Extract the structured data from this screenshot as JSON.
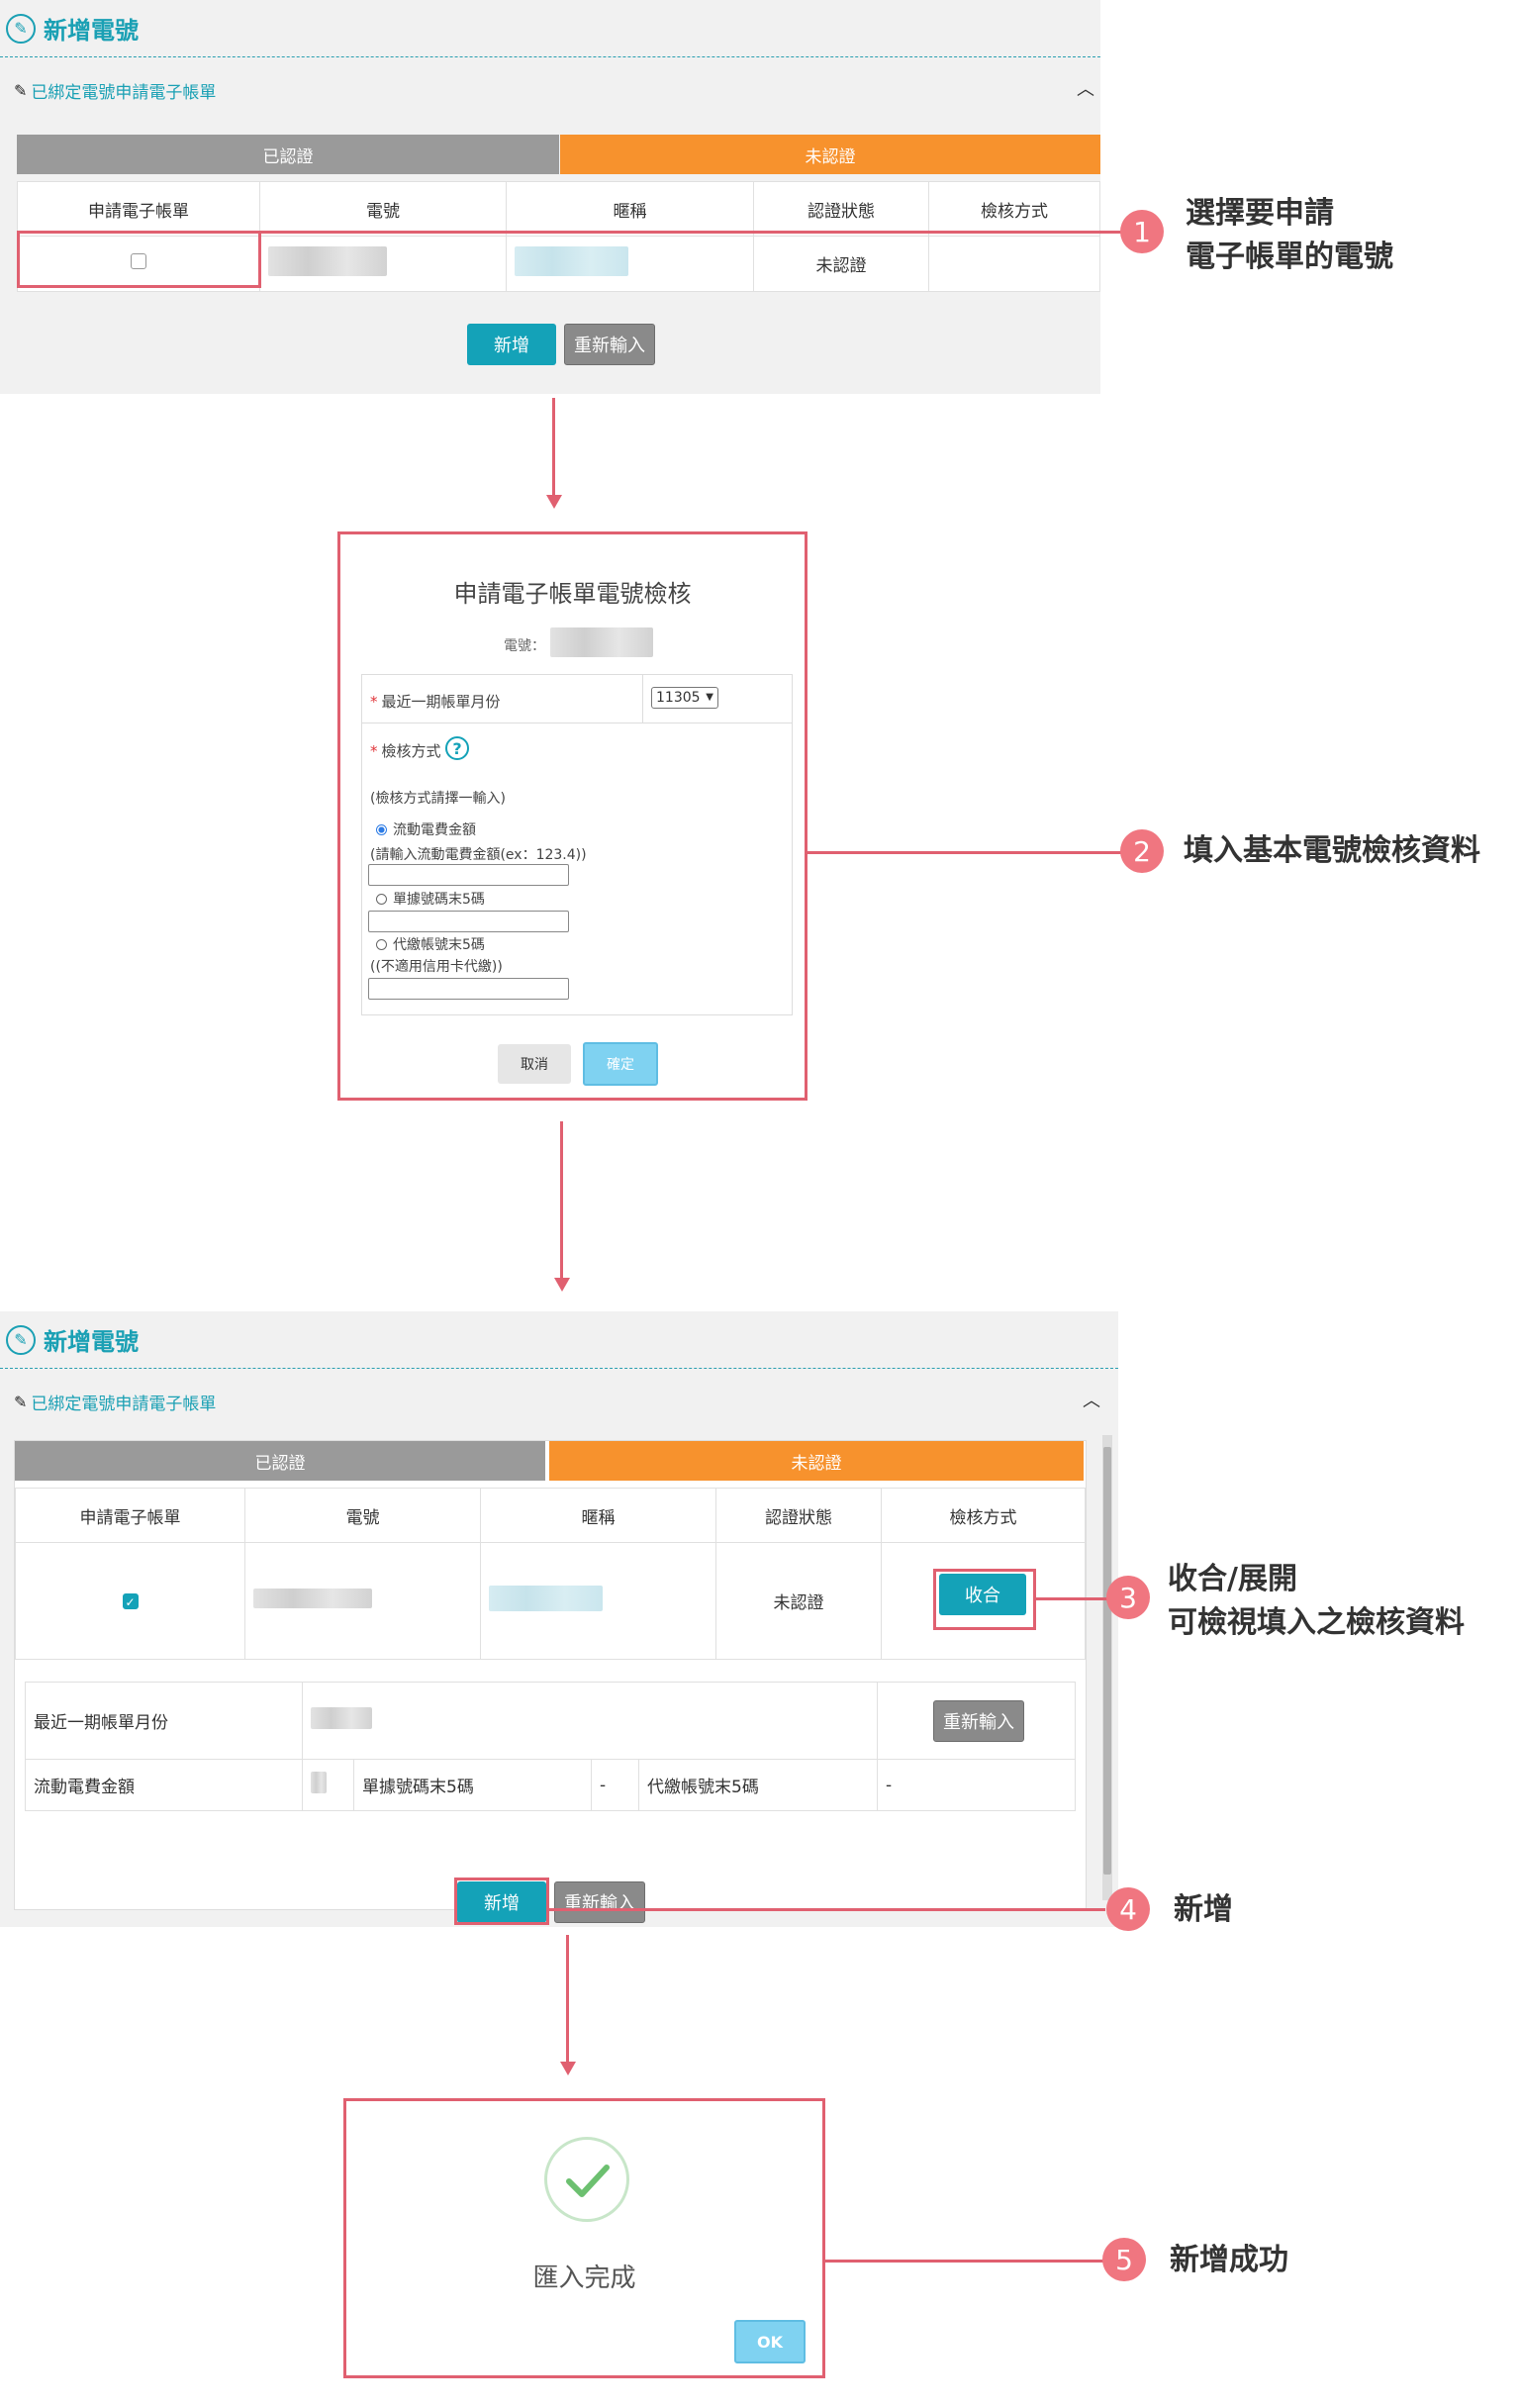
{
  "panel1": {
    "title": "新增電號",
    "section": "已綁定電號申請電子帳單",
    "tab_verified": "已認證",
    "tab_unverified": "未認證",
    "headers": [
      "申請電子帳單",
      "電號",
      "暱稱",
      "認證狀態",
      "檢核方式"
    ],
    "row_status": "未認證",
    "btn_add": "新增",
    "btn_reset": "重新輸入"
  },
  "dialog": {
    "title": "申請電子帳單電號檢核",
    "account_label": "電號：",
    "latest_month_label": "最近一期帳單月份",
    "month_value": "11305",
    "method_label": "檢核方式",
    "method_hint": "(檢核方式請擇一輸入)",
    "opt1": "流動電費金額",
    "opt1_hint": "(請輸入流動電費金額(ex：123.4))",
    "opt2": "單據號碼末5碼",
    "opt3": "代繳帳號末5碼",
    "opt3_hint": "((不適用信用卡代繳))",
    "btn_cancel": "取消",
    "btn_ok": "確定"
  },
  "panel2": {
    "title": "新增電號",
    "section": "已綁定電號申請電子帳單",
    "tab_verified": "已認證",
    "tab_unverified": "未認證",
    "headers": [
      "申請電子帳單",
      "電號",
      "暱稱",
      "認證狀態",
      "檢核方式"
    ],
    "row_status": "未認證",
    "btn_collapse": "收合",
    "detail_month_label": "最近一期帳單月份",
    "detail_reset": "重新輸入",
    "detail_amount_label": "流動電費金額",
    "detail_receipt_label": "單據號碼末5碼",
    "detail_receipt_value": "-",
    "detail_account_label": "代繳帳號末5碼",
    "detail_account_value": "-",
    "btn_add": "新增",
    "btn_reset": "重新輸入"
  },
  "success": {
    "message": "匯入完成",
    "btn_ok": "OK"
  },
  "annotations": {
    "n1": "1",
    "a1_line1": "選擇要申請",
    "a1_line2": "電子帳單的電號",
    "n2": "2",
    "a2": "填入基本電號檢核資料",
    "n3": "3",
    "a3_line1": "收合/展開",
    "a3_line2": "可檢視填入之檢核資料",
    "n4": "4",
    "a4": "新增",
    "n5": "5",
    "a5": "新增成功"
  },
  "colors": {
    "accent": "#14a2b8",
    "orange": "#f7922d",
    "annotation_red": "#e06070",
    "badge": "#f07680"
  }
}
